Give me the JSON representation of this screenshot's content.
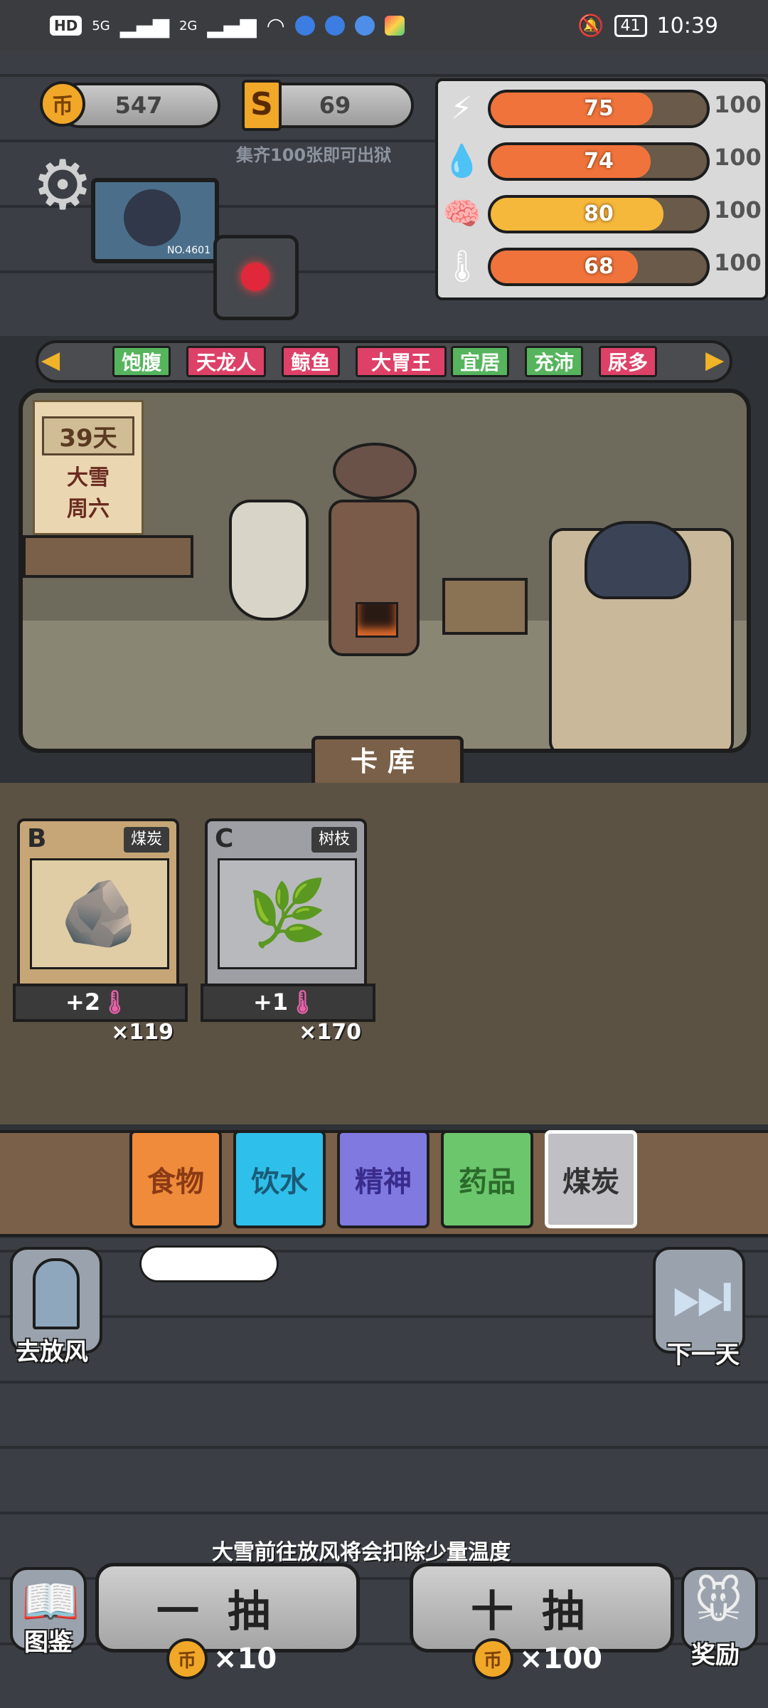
{
  "status_bar": {
    "network": "HD",
    "signal1": "5G",
    "signal2": "2G",
    "battery": "41",
    "time": "10:39"
  },
  "top": {
    "coins": "547",
    "s_cards": "69",
    "hint": "集齐100张即可出狱"
  },
  "stats": [
    {
      "icon": "lightning-icon",
      "value": "75",
      "max": "100",
      "fill": 0.75,
      "color": "#f0733b"
    },
    {
      "icon": "water-drop-icon",
      "value": "74",
      "max": "100",
      "fill": 0.74,
      "color": "#f0733b"
    },
    {
      "icon": "brain-icon",
      "value": "80",
      "max": "100",
      "fill": 0.8,
      "color": "#f5b83b"
    },
    {
      "icon": "thermometer-icon",
      "value": "68",
      "max": "100",
      "fill": 0.68,
      "color": "#f0733b"
    }
  ],
  "traits": [
    {
      "label": "饱腹",
      "color": "#56b45d"
    },
    {
      "label": "天龙人",
      "color": "#dd4167"
    },
    {
      "label": "鲸鱼",
      "color": "#dd4167"
    },
    {
      "label": "大胃王",
      "color": "#dd4167"
    },
    {
      "label": "宜居",
      "color": "#56b45d"
    },
    {
      "label": "充沛",
      "color": "#56b45d"
    },
    {
      "label": "尿多",
      "color": "#dd4167"
    }
  ],
  "calendar": {
    "day": "39天",
    "weather": "大雪",
    "weekday": "周六"
  },
  "monitor_label": "NO.4601",
  "section_title": "卡库",
  "cards": [
    {
      "rank": "B",
      "name": "煤炭",
      "effect": "+2",
      "count": "×119",
      "color": "#c6a676"
    },
    {
      "rank": "C",
      "name": "树枝",
      "effect": "+1",
      "count": "×170",
      "color": "#9d9fa5"
    }
  ],
  "categories": [
    {
      "label": "食物",
      "color": "#ef8b3b",
      "text": "#8a3a14"
    },
    {
      "label": "饮水",
      "color": "#2ec0ea",
      "text": "#1a5b78"
    },
    {
      "label": "精神",
      "color": "#7f79e0",
      "text": "#3a2c8c"
    },
    {
      "label": "药品",
      "color": "#6cc66c",
      "text": "#2a6a2a"
    },
    {
      "label": "煤炭",
      "color": "#bfbfc4",
      "text": "#333333"
    }
  ],
  "actions": {
    "go_out": "去放风",
    "next_day": "下一天",
    "warning": "大雪前往放风将会扣除少量温度",
    "draw_one": "一抽",
    "draw_one_price": "×10",
    "draw_ten": "十抽",
    "draw_ten_price": "×100",
    "album": "图鉴",
    "reward": "奖励",
    "coin_symbol": "币",
    "s_symbol": "S"
  }
}
